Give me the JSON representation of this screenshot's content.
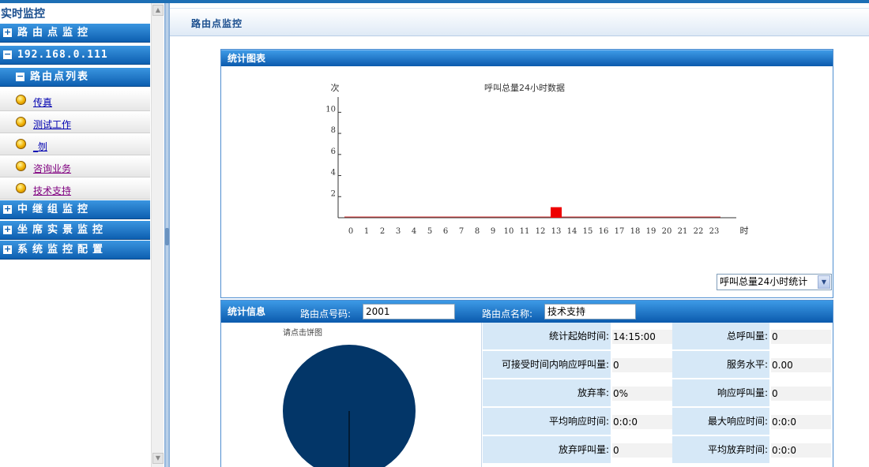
{
  "sidebar": {
    "title": "实时监控",
    "items": [
      {
        "label": "路由点监控",
        "kind": "group",
        "expanded": false
      },
      {
        "label": "192.168.0.111",
        "kind": "group",
        "expanded": true
      },
      {
        "label": "路由点列表",
        "kind": "subgroup",
        "expanded": true
      },
      {
        "label": "传真",
        "kind": "leaf"
      },
      {
        "label": "测试工作",
        "kind": "leaf"
      },
      {
        "label": "_刎",
        "kind": "leaf"
      },
      {
        "label": "咨询业务",
        "kind": "leaf",
        "visited": true
      },
      {
        "label": "技术支持",
        "kind": "leaf",
        "visited": true
      },
      {
        "label": "中继组监控",
        "kind": "group",
        "expanded": false
      },
      {
        "label": "坐席实景监控",
        "kind": "group",
        "expanded": false
      },
      {
        "label": "系统监控配置",
        "kind": "group",
        "expanded": false
      }
    ]
  },
  "header": {
    "title": "路由点监控"
  },
  "chart_panel": {
    "title": "统计图表",
    "select_value": "呼叫总量24小时统计"
  },
  "chart_data": {
    "type": "bar",
    "title": "呼叫总量24小时数据",
    "ylabel": "次",
    "xlabel": "时",
    "categories": [
      "0",
      "1",
      "2",
      "3",
      "4",
      "5",
      "6",
      "7",
      "8",
      "9",
      "10",
      "11",
      "12",
      "13",
      "14",
      "15",
      "16",
      "17",
      "18",
      "19",
      "20",
      "21",
      "22",
      "23"
    ],
    "values": [
      0,
      0,
      0,
      0,
      0,
      0,
      0,
      0,
      0,
      0,
      0,
      0,
      0,
      1,
      0,
      0,
      0,
      0,
      0,
      0,
      0,
      0,
      0,
      0
    ],
    "ylim": [
      0,
      11
    ],
    "yticks": [
      2,
      4,
      6,
      8,
      10
    ],
    "bar_color": "#ee0000",
    "grid": false
  },
  "info_panel": {
    "title": "统计信息",
    "route_code_label": "路由点号码:",
    "route_code": "2001",
    "route_name_label": "路由点名称:",
    "route_name": "技术支持",
    "pie_hint": "请点击饼图",
    "pie_color": "#033668",
    "stats": [
      {
        "label": "统计起始时间:",
        "value": "14:15:00",
        "label2": "总呼叫量:",
        "value2": "0"
      },
      {
        "label": "可接受时间内响应呼叫量:",
        "value": "0",
        "label2": "服务水平:",
        "value2": "0.00"
      },
      {
        "label": "放弃率:",
        "value": "0%",
        "label2": "响应呼叫量:",
        "value2": "0"
      },
      {
        "label": "平均响应时间:",
        "value": "0:0:0",
        "label2": "最大响应时间:",
        "value2": "0:0:0"
      },
      {
        "label": "放弃呼叫量:",
        "value": "0",
        "label2": "平均放弃时间:",
        "value2": "0:0:0"
      }
    ]
  }
}
